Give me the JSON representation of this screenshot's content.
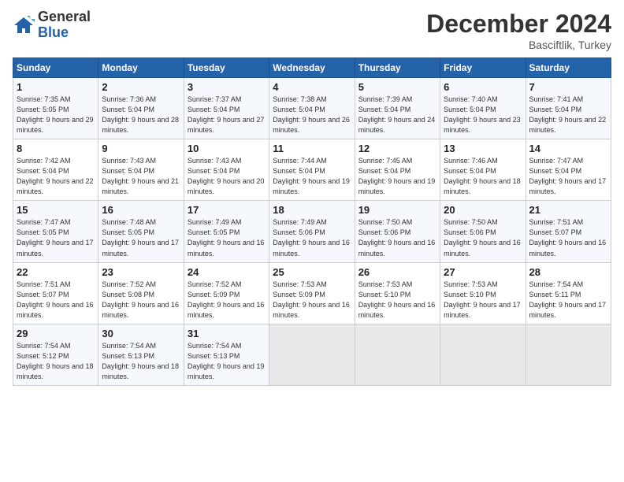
{
  "logo": {
    "line1": "General",
    "line2": "Blue"
  },
  "header": {
    "month": "December 2024",
    "location": "Basciftlik, Turkey"
  },
  "days_of_week": [
    "Sunday",
    "Monday",
    "Tuesday",
    "Wednesday",
    "Thursday",
    "Friday",
    "Saturday"
  ],
  "weeks": [
    [
      {
        "day": "1",
        "rise": "Sunrise: 7:35 AM",
        "set": "Sunset: 5:05 PM",
        "light": "Daylight: 9 hours and 29 minutes."
      },
      {
        "day": "2",
        "rise": "Sunrise: 7:36 AM",
        "set": "Sunset: 5:04 PM",
        "light": "Daylight: 9 hours and 28 minutes."
      },
      {
        "day": "3",
        "rise": "Sunrise: 7:37 AM",
        "set": "Sunset: 5:04 PM",
        "light": "Daylight: 9 hours and 27 minutes."
      },
      {
        "day": "4",
        "rise": "Sunrise: 7:38 AM",
        "set": "Sunset: 5:04 PM",
        "light": "Daylight: 9 hours and 26 minutes."
      },
      {
        "day": "5",
        "rise": "Sunrise: 7:39 AM",
        "set": "Sunset: 5:04 PM",
        "light": "Daylight: 9 hours and 24 minutes."
      },
      {
        "day": "6",
        "rise": "Sunrise: 7:40 AM",
        "set": "Sunset: 5:04 PM",
        "light": "Daylight: 9 hours and 23 minutes."
      },
      {
        "day": "7",
        "rise": "Sunrise: 7:41 AM",
        "set": "Sunset: 5:04 PM",
        "light": "Daylight: 9 hours and 22 minutes."
      }
    ],
    [
      {
        "day": "8",
        "rise": "Sunrise: 7:42 AM",
        "set": "Sunset: 5:04 PM",
        "light": "Daylight: 9 hours and 22 minutes."
      },
      {
        "day": "9",
        "rise": "Sunrise: 7:43 AM",
        "set": "Sunset: 5:04 PM",
        "light": "Daylight: 9 hours and 21 minutes."
      },
      {
        "day": "10",
        "rise": "Sunrise: 7:43 AM",
        "set": "Sunset: 5:04 PM",
        "light": "Daylight: 9 hours and 20 minutes."
      },
      {
        "day": "11",
        "rise": "Sunrise: 7:44 AM",
        "set": "Sunset: 5:04 PM",
        "light": "Daylight: 9 hours and 19 minutes."
      },
      {
        "day": "12",
        "rise": "Sunrise: 7:45 AM",
        "set": "Sunset: 5:04 PM",
        "light": "Daylight: 9 hours and 19 minutes."
      },
      {
        "day": "13",
        "rise": "Sunrise: 7:46 AM",
        "set": "Sunset: 5:04 PM",
        "light": "Daylight: 9 hours and 18 minutes."
      },
      {
        "day": "14",
        "rise": "Sunrise: 7:47 AM",
        "set": "Sunset: 5:04 PM",
        "light": "Daylight: 9 hours and 17 minutes."
      }
    ],
    [
      {
        "day": "15",
        "rise": "Sunrise: 7:47 AM",
        "set": "Sunset: 5:05 PM",
        "light": "Daylight: 9 hours and 17 minutes."
      },
      {
        "day": "16",
        "rise": "Sunrise: 7:48 AM",
        "set": "Sunset: 5:05 PM",
        "light": "Daylight: 9 hours and 17 minutes."
      },
      {
        "day": "17",
        "rise": "Sunrise: 7:49 AM",
        "set": "Sunset: 5:05 PM",
        "light": "Daylight: 9 hours and 16 minutes."
      },
      {
        "day": "18",
        "rise": "Sunrise: 7:49 AM",
        "set": "Sunset: 5:06 PM",
        "light": "Daylight: 9 hours and 16 minutes."
      },
      {
        "day": "19",
        "rise": "Sunrise: 7:50 AM",
        "set": "Sunset: 5:06 PM",
        "light": "Daylight: 9 hours and 16 minutes."
      },
      {
        "day": "20",
        "rise": "Sunrise: 7:50 AM",
        "set": "Sunset: 5:06 PM",
        "light": "Daylight: 9 hours and 16 minutes."
      },
      {
        "day": "21",
        "rise": "Sunrise: 7:51 AM",
        "set": "Sunset: 5:07 PM",
        "light": "Daylight: 9 hours and 16 minutes."
      }
    ],
    [
      {
        "day": "22",
        "rise": "Sunrise: 7:51 AM",
        "set": "Sunset: 5:07 PM",
        "light": "Daylight: 9 hours and 16 minutes."
      },
      {
        "day": "23",
        "rise": "Sunrise: 7:52 AM",
        "set": "Sunset: 5:08 PM",
        "light": "Daylight: 9 hours and 16 minutes."
      },
      {
        "day": "24",
        "rise": "Sunrise: 7:52 AM",
        "set": "Sunset: 5:09 PM",
        "light": "Daylight: 9 hours and 16 minutes."
      },
      {
        "day": "25",
        "rise": "Sunrise: 7:53 AM",
        "set": "Sunset: 5:09 PM",
        "light": "Daylight: 9 hours and 16 minutes."
      },
      {
        "day": "26",
        "rise": "Sunrise: 7:53 AM",
        "set": "Sunset: 5:10 PM",
        "light": "Daylight: 9 hours and 16 minutes."
      },
      {
        "day": "27",
        "rise": "Sunrise: 7:53 AM",
        "set": "Sunset: 5:10 PM",
        "light": "Daylight: 9 hours and 17 minutes."
      },
      {
        "day": "28",
        "rise": "Sunrise: 7:54 AM",
        "set": "Sunset: 5:11 PM",
        "light": "Daylight: 9 hours and 17 minutes."
      }
    ],
    [
      {
        "day": "29",
        "rise": "Sunrise: 7:54 AM",
        "set": "Sunset: 5:12 PM",
        "light": "Daylight: 9 hours and 18 minutes."
      },
      {
        "day": "30",
        "rise": "Sunrise: 7:54 AM",
        "set": "Sunset: 5:13 PM",
        "light": "Daylight: 9 hours and 18 minutes."
      },
      {
        "day": "31",
        "rise": "Sunrise: 7:54 AM",
        "set": "Sunset: 5:13 PM",
        "light": "Daylight: 9 hours and 19 minutes."
      },
      null,
      null,
      null,
      null
    ]
  ]
}
